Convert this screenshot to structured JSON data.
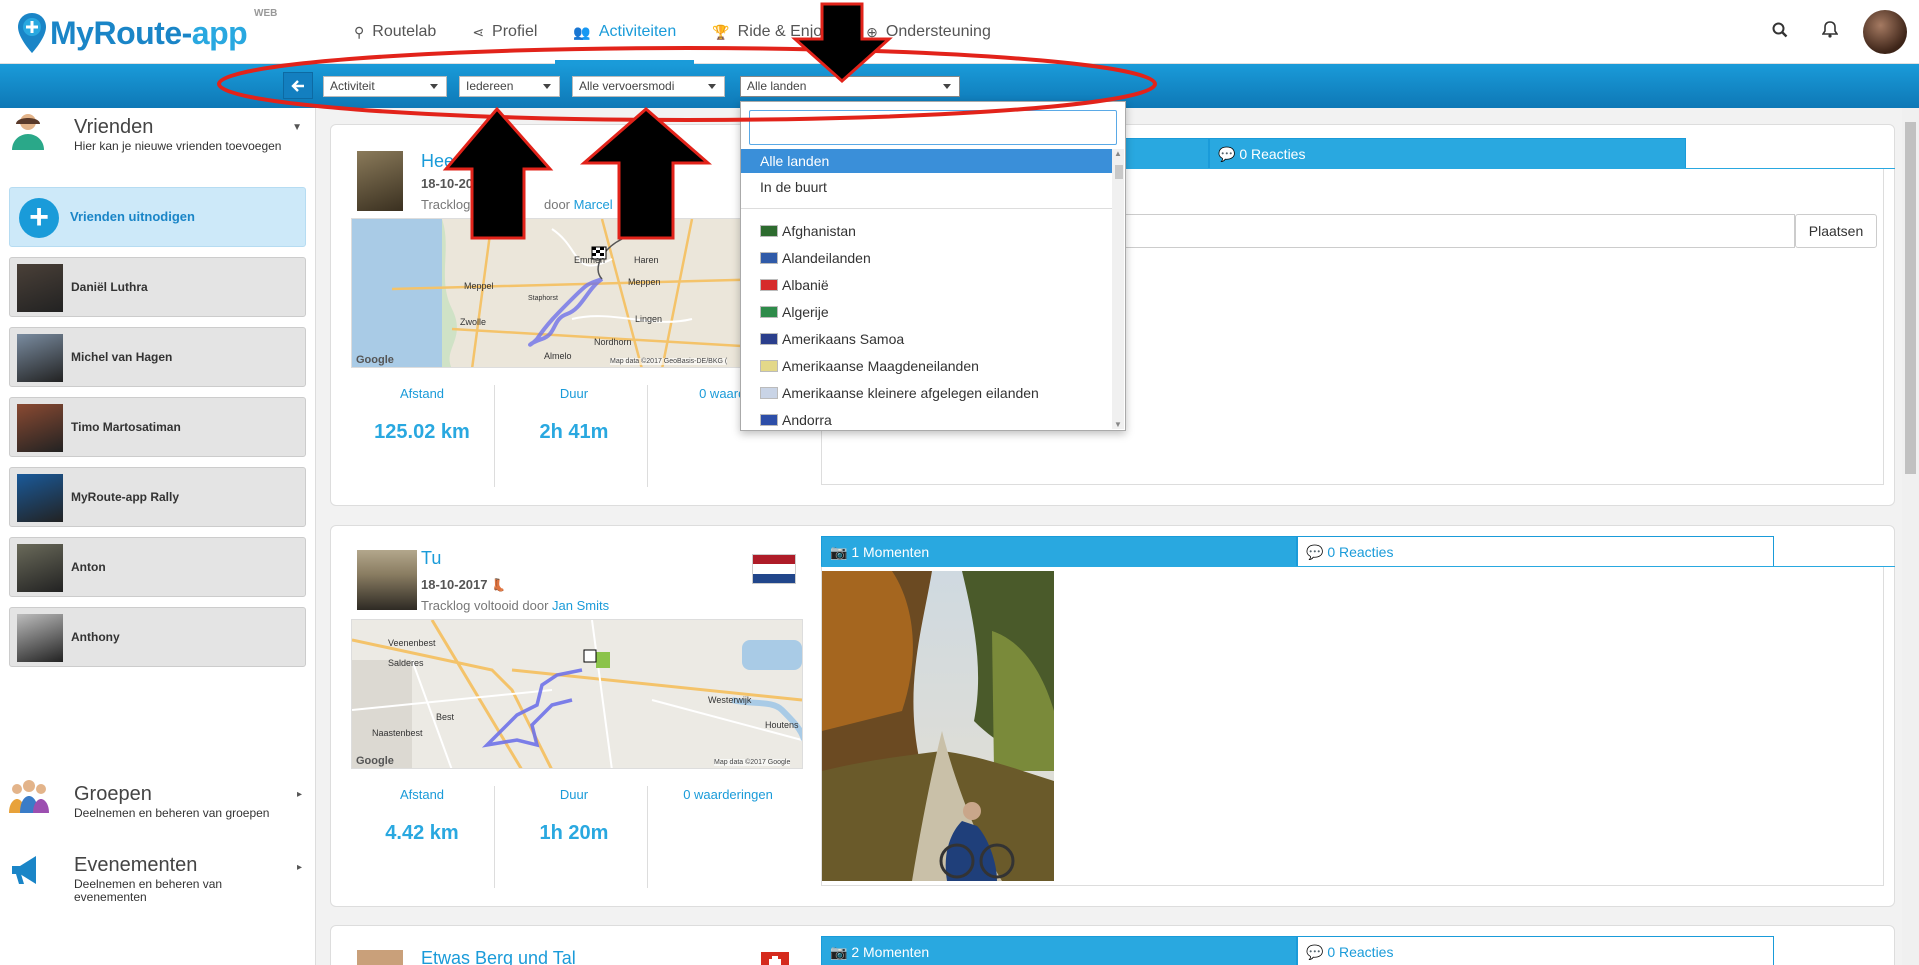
{
  "brand": {
    "name_prefix": "MyRoute-",
    "name_suffix": "app",
    "badge": "WEB"
  },
  "nav": {
    "items": [
      {
        "label": "Routelab",
        "icon": "map-pin-icon"
      },
      {
        "label": "Profiel",
        "icon": "share-icon"
      },
      {
        "label": "Activiteiten",
        "icon": "users-icon",
        "active": true
      },
      {
        "label": "Ride & Enjoy",
        "icon": "trophy-icon"
      },
      {
        "label": "Ondersteuning",
        "icon": "support-icon"
      }
    ]
  },
  "filters": {
    "activity": "Activiteit",
    "who": "Iedereen",
    "transport": "Alle vervoersmodi",
    "country": "Alle landen"
  },
  "dropdown": {
    "search_value": "",
    "selected": "Alle landen",
    "special": [
      "Alle landen",
      "In de buurt"
    ],
    "countries": [
      {
        "name": "Afghanistan",
        "color": "#2d6b2f"
      },
      {
        "name": "Alandeilanden",
        "color": "#2f5aa8"
      },
      {
        "name": "Albanië",
        "color": "#d62b2b"
      },
      {
        "name": "Algerije",
        "color": "#2e8b4a"
      },
      {
        "name": "Amerikaans Samoa",
        "color": "#2b3f8c"
      },
      {
        "name": "Amerikaanse Maagdeneilanden",
        "color": "#e3d889"
      },
      {
        "name": "Amerikaanse kleinere afgelegen eilanden",
        "color": "#c9d4e6"
      },
      {
        "name": "Andorra",
        "color": "#2d4ea8"
      }
    ]
  },
  "sidebar": {
    "friends": {
      "title": "Vrienden",
      "subtitle": "Hier kan je nieuwe vrienden toevoegen"
    },
    "invite_label": "Vrienden uitnodigen",
    "friend_list": [
      {
        "name": "Daniël Luthra",
        "color": "#4a4038"
      },
      {
        "name": "Michel van Hagen",
        "color": "#7a8ca0"
      },
      {
        "name": "Timo Martosatiman",
        "color": "#8a4a32"
      },
      {
        "name": "MyRoute-app Rally",
        "color": "#1a5a9a"
      },
      {
        "name": "Anton",
        "color": "#6a6a5a"
      },
      {
        "name": "Anthony",
        "color": "#bdbdbd"
      }
    ],
    "groups": {
      "title": "Groepen",
      "subtitle": "Deelnemen en beheren van groepen"
    },
    "events": {
      "title": "Evenementen",
      "subtitle": "Deelnemen en beheren van evenementen"
    }
  },
  "feed": [
    {
      "title": "Heer",
      "date": "18-10-20",
      "sub_prefix": "Tracklog ",
      "sub_mid": "door ",
      "author": "Marcel",
      "map_labels": [
        "Zwolle",
        "Meppel",
        "Emmen",
        "Haren",
        "Meppen",
        "Lingen",
        "Nordhorn",
        "Almelo",
        "Staphorst",
        "Map data ©2017 GeoBasis-DE/BKG (",
        "Google"
      ],
      "distance_label": "Afstand",
      "distance": "125.02 km",
      "duration_label": "Duur",
      "duration": "2h 41m",
      "rating_label": "0 waarder",
      "moments": "",
      "reactions": "0 Reacties",
      "post_label": "Plaatsen"
    },
    {
      "title": "Tu",
      "date": "18-10-2017",
      "sub_prefix": "Tracklog voltooid door ",
      "author": "Jan Smits",
      "map_labels": [
        "Veenenbest",
        "Salderes",
        "Best",
        "Naastenbest",
        "Westerwijk",
        "Houtens",
        "Map data ©2017 Google",
        "Google"
      ],
      "distance_label": "Afstand",
      "distance": "4.42 km",
      "duration_label": "Duur",
      "duration": "1h 20m",
      "rating_label": "0 waarderingen",
      "moments": "1 Momenten",
      "reactions": "0 Reacties"
    },
    {
      "title": "Etwas Berg und Tal",
      "moments": "2 Momenten",
      "reactions": "0 Reacties"
    }
  ],
  "colors": {
    "primary": "#1a9bd9",
    "annotation_red": "#e2231a"
  }
}
